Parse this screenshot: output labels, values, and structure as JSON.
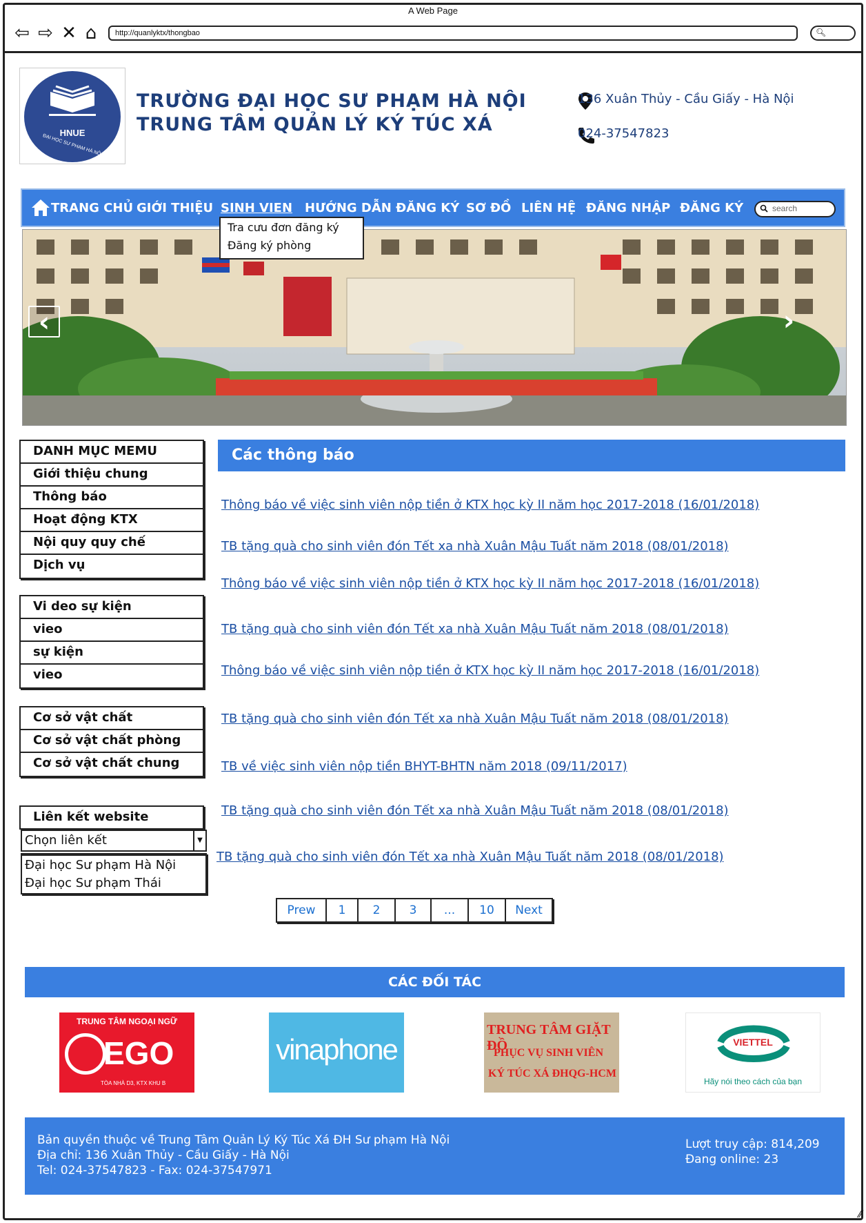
{
  "window": {
    "title": "A Web Page",
    "url": "http://quanlyktx/thongbao"
  },
  "header": {
    "logo_text": "HNUE",
    "logo_sub": "ĐẠI HỌC SƯ PHẠM HÀ NỘI",
    "school_line1": "TRƯỜNG ĐẠI HỌC SƯ PHẠM HÀ NỘI",
    "school_line2": "TRUNG TÂM QUẢN LÝ KÝ TÚC XÁ",
    "address": "136 Xuân Thủy - Cầu Giấy - Hà Nội",
    "phone": "024-37547823"
  },
  "nav": {
    "items": [
      "TRANG CHỦ",
      "GIỚI THIỆU",
      "SINH VIEN",
      "HƯỚNG DẪN ĐĂNG KÝ",
      "SƠ ĐỒ",
      "LIÊN HỆ",
      "ĐĂNG NHẬP",
      "ĐĂNG KÝ"
    ],
    "search_placeholder": "search",
    "dropdown": [
      "Tra cưu đơn đăng ký",
      "Đăng ký phòng"
    ]
  },
  "banner": {
    "prev": "‹",
    "next": "›"
  },
  "sidebar": {
    "menu": [
      "DANH MỤC MEMU",
      "Giới thiệu chung",
      "Thông báo",
      "Hoạt động KTX",
      "Nội quy quy chế",
      "Dịch vụ"
    ],
    "video": [
      "Vi deo sự kiện",
      "vieo",
      "sự kiện",
      "vieo"
    ],
    "facilities": [
      "Cơ sở vật chất",
      "Cơ sở vật chất phòng",
      "Cơ sở vật chất chung"
    ],
    "links_title": "Liên kết website",
    "links_select": "Chọn liên kết",
    "links_options": [
      "Đại học Sư phạm Hà Nội",
      "Đại học Sư phạm Thái"
    ]
  },
  "main": {
    "title": "Các thông báo",
    "notices": [
      "Thông báo về việc sinh viên nộp tiền ở KTX học kỳ II năm học 2017-2018 (16/01/2018)",
      "TB tặng quà cho sinh viên đón Tết xa nhà Xuân Mậu Tuất năm 2018 (08/01/2018)",
      "Thông báo về việc sinh viên nộp tiền ở KTX học kỳ II năm học 2017-2018 (16/01/2018)",
      "TB tặng quà cho sinh viên đón Tết xa nhà Xuân Mậu Tuất năm 2018 (08/01/2018)",
      "Thông báo về việc sinh viên nộp tiền ở KTX học kỳ II năm học 2017-2018 (16/01/2018)",
      "TB tặng quà cho sinh viên đón Tết xa nhà Xuân Mậu Tuất năm 2018 (08/01/2018)",
      "TB về việc sinh viên nộp tiền BHYT-BHTN năm 2018 (09/11/2017)",
      "TB tặng quà cho sinh viên đón Tết xa nhà Xuân Mậu Tuất năm 2018 (08/01/2018)",
      "TB tặng quà cho sinh viên đón Tết xa nhà Xuân Mậu Tuất năm 2018 (08/01/2018)"
    ],
    "pager": [
      "Prew",
      "1",
      "2",
      "3",
      "...",
      "10",
      "Next"
    ]
  },
  "partners": {
    "title": "CÁC ĐỐI TÁC",
    "ego_top": "TRUNG TÂM NGOẠI NGỮ",
    "ego_name": "EGO",
    "ego_sub": "TÒA NHÀ D3, KTX KHU B",
    "vina": "vinaphone",
    "laundry": [
      "TRUNG TÂM GIẶT ĐỒ",
      "PHỤC VỤ SINH VIÊN",
      "KÝ TÚC XÁ ĐHQG-HCM"
    ],
    "viettel": "VIETTEL",
    "viettel_slogan": "Hãy nói theo cách của bạn"
  },
  "footer": {
    "line1": "Bản quyền thuộc về Trung Tâm Quản Lý Ký Túc Xá ĐH Sư phạm Hà Nội",
    "line2": "Địa chỉ: 136 Xuân Thủy - Cầu Giấy - Hà Nội",
    "line3": "Tel: 024-37547823 - Fax: 024-37547971",
    "visits": "Lượt truy cập: 814,209",
    "online": "Đang online: 23"
  },
  "colors": {
    "primary": "#3a7fe0",
    "title_text": "#1d3e7a",
    "link": "#1b4fa3"
  }
}
